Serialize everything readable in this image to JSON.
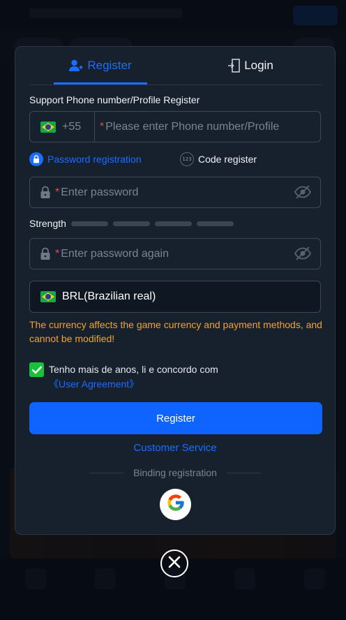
{
  "tabs": [
    {
      "label": "Register",
      "icon": "add-user-icon",
      "active": true
    },
    {
      "label": "Login",
      "icon": "login-door-icon",
      "active": false
    }
  ],
  "support_label": "Support Phone number/Profile Register",
  "phone": {
    "country_code": "+55",
    "flag": "brazil-flag",
    "required_mark": "*",
    "placeholder": "Please enter Phone number/Profile"
  },
  "registration_modes": {
    "password": "Password registration",
    "code": "Code register",
    "code_badge": "123"
  },
  "password": {
    "required_mark": "*",
    "placeholder": "Enter password",
    "confirm_placeholder": "Enter password again"
  },
  "strength": {
    "label": "Strength",
    "segments": 4,
    "filled": 0
  },
  "currency": {
    "value": "BRL(Brazilian real)",
    "warning": "The currency affects the game currency and payment methods, and cannot be modified!"
  },
  "agreement": {
    "checked": true,
    "text": "Tenho mais de anos, li e concordo com ",
    "link": "《User Agreement》"
  },
  "register_button": "Register",
  "customer_service": "Customer Service",
  "binding_label": "Binding registration",
  "colors": {
    "accent": "#1a6dff",
    "warning": "#f5a323",
    "check": "#16c23b",
    "required": "#e84848"
  }
}
